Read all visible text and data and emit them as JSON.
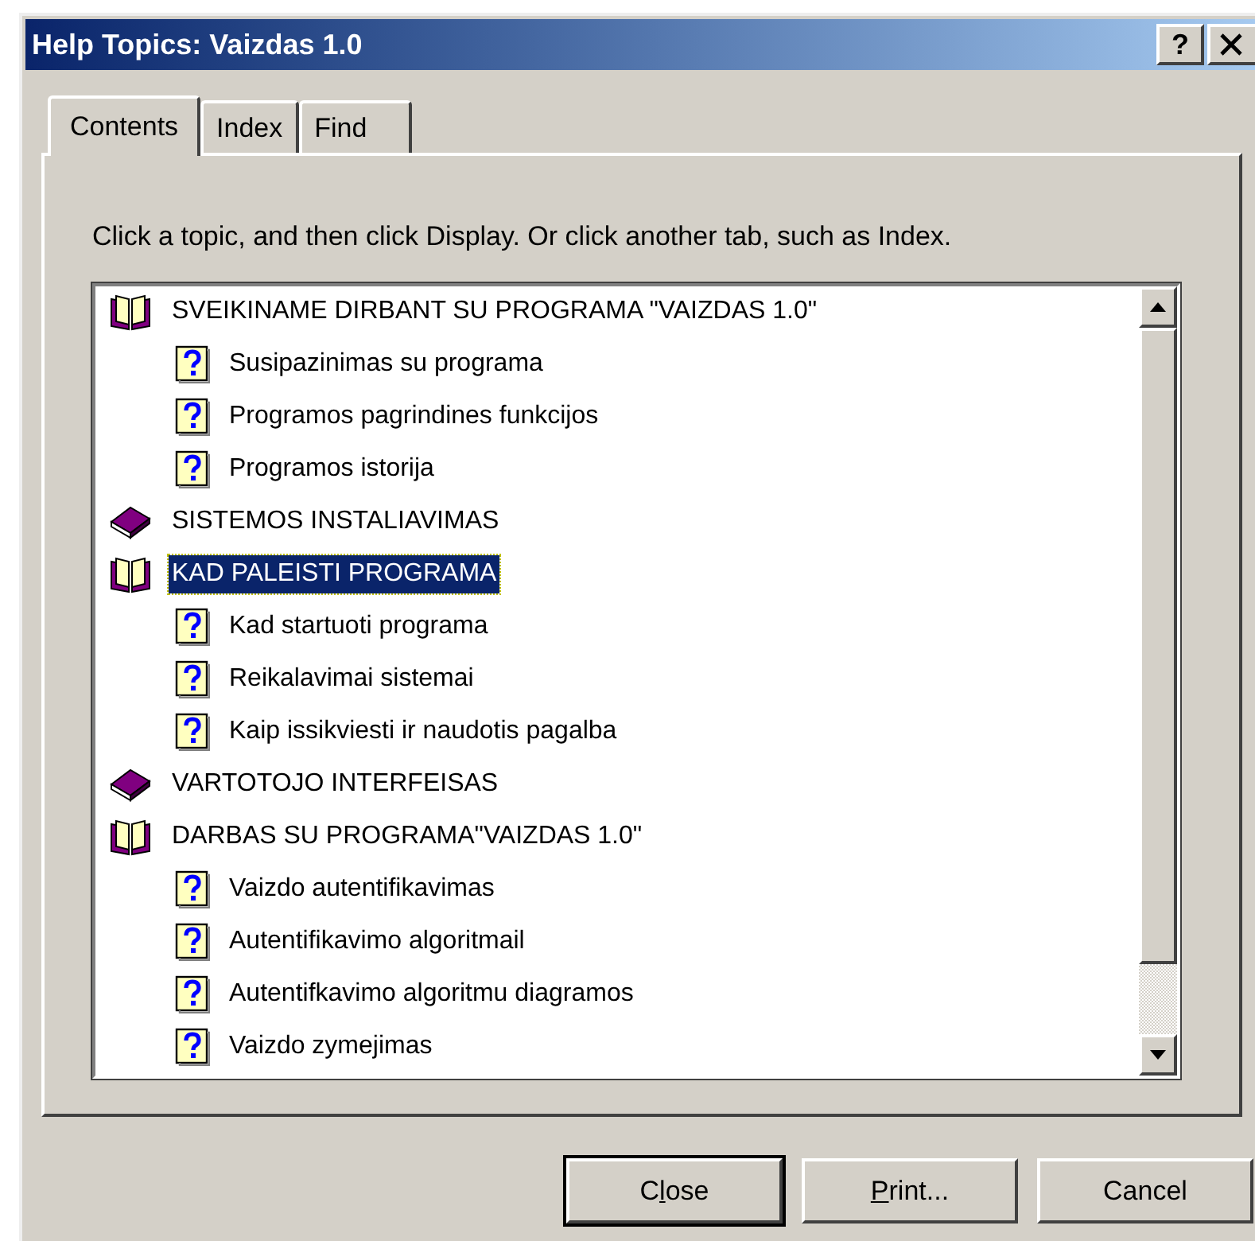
{
  "window": {
    "title": "Help Topics: Vaizdas 1.0",
    "help_button": "?"
  },
  "tabs": [
    {
      "label": "Contents",
      "selected": true
    },
    {
      "label": "Index",
      "selected": false
    },
    {
      "label": "Find",
      "selected": false
    }
  ],
  "instruction": "Click a topic, and then click Display. Or click another tab, such as Index.",
  "tree": [
    {
      "label": "SVEIKINAME DIRBANT SU PROGRAMA \"VAIZDAS 1.0\"",
      "kind": "book",
      "expanded": true,
      "selected": false,
      "children": [
        {
          "label": "Susipazinimas su programa",
          "kind": "topic",
          "selected": false
        },
        {
          "label": "Programos pagrindines funkcijos",
          "kind": "topic",
          "selected": false
        },
        {
          "label": "Programos istorija",
          "kind": "topic",
          "selected": false
        }
      ]
    },
    {
      "label": "SISTEMOS INSTALIAVIMAS",
      "kind": "book",
      "expanded": false,
      "selected": false
    },
    {
      "label": "KAD PALEISTI PROGRAMA",
      "kind": "book",
      "expanded": true,
      "selected": true,
      "children": [
        {
          "label": "Kad startuoti programa",
          "kind": "topic",
          "selected": false
        },
        {
          "label": "Reikalavimai sistemai",
          "kind": "topic",
          "selected": false
        },
        {
          "label": "Kaip issikviesti ir naudotis pagalba",
          "kind": "topic",
          "selected": false
        }
      ]
    },
    {
      "label": "VARTOTOJO INTERFEISAS",
      "kind": "book",
      "expanded": false,
      "selected": false
    },
    {
      "label": "DARBAS SU PROGRAMA\"VAIZDAS 1.0\"",
      "kind": "book",
      "expanded": true,
      "selected": false,
      "children": [
        {
          "label": "Vaizdo autentifikavimas",
          "kind": "topic",
          "selected": false
        },
        {
          "label": "Autentifikavimo algoritmail",
          "kind": "topic",
          "selected": false
        },
        {
          "label": "Autentifkavimo algoritmu diagramos",
          "kind": "topic",
          "selected": false
        },
        {
          "label": "Vaizdo zymejimas",
          "kind": "topic",
          "selected": false
        }
      ]
    }
  ],
  "buttons": [
    {
      "before": "C",
      "accel": "l",
      "after": "ose",
      "default": true
    },
    {
      "accel": "P",
      "after": "rint...",
      "default": false
    },
    {
      "before": "Cancel",
      "default": false
    }
  ]
}
